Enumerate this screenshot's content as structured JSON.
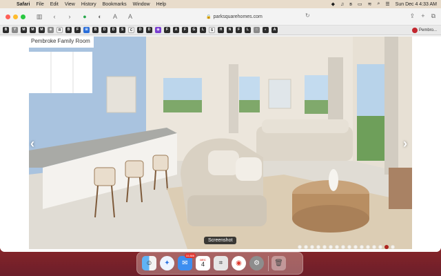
{
  "menubar": {
    "app_name": "Safari",
    "menus": [
      "File",
      "Edit",
      "View",
      "History",
      "Bookmarks",
      "Window",
      "Help"
    ],
    "clock": "Sun Dec 4  4:33 AM",
    "status_icons": [
      "dropbox-icon",
      "music-icon",
      "bluetooth-icon",
      "battery-icon",
      "wifi-icon",
      "search-icon",
      "control-center-icon"
    ]
  },
  "toolbar": {
    "url": "parksquarehomes.com"
  },
  "favorites": {
    "letters": [
      "B",
      "Y",
      "M",
      "M",
      "M",
      "⊕",
      "R",
      "B",
      "F",
      "⊞",
      "B",
      "D",
      "D",
      "S",
      "C",
      "D",
      "D",
      "◉",
      "F",
      "A",
      "F",
      "G",
      "L",
      "S",
      "H",
      "N",
      "F",
      "L",
      "☆",
      "◐",
      "A"
    ],
    "open_tab_label": "Pembro..."
  },
  "page": {
    "slide_label": "Pembroke Family Room",
    "dots_total": 16,
    "active_dot": 14,
    "tooltip": "Screenshot"
  },
  "dock": {
    "calendar_month": "DEC",
    "calendar_day": "4",
    "mail_badge": "10,888",
    "apps": [
      "Finder",
      "Safari",
      "Mail",
      "Calendar",
      "Screenshot",
      "Chrome",
      "System Preferences",
      "Trash"
    ]
  },
  "colors": {
    "accent_red": "#b3241f",
    "wall_blue": "#a8c4e0"
  }
}
